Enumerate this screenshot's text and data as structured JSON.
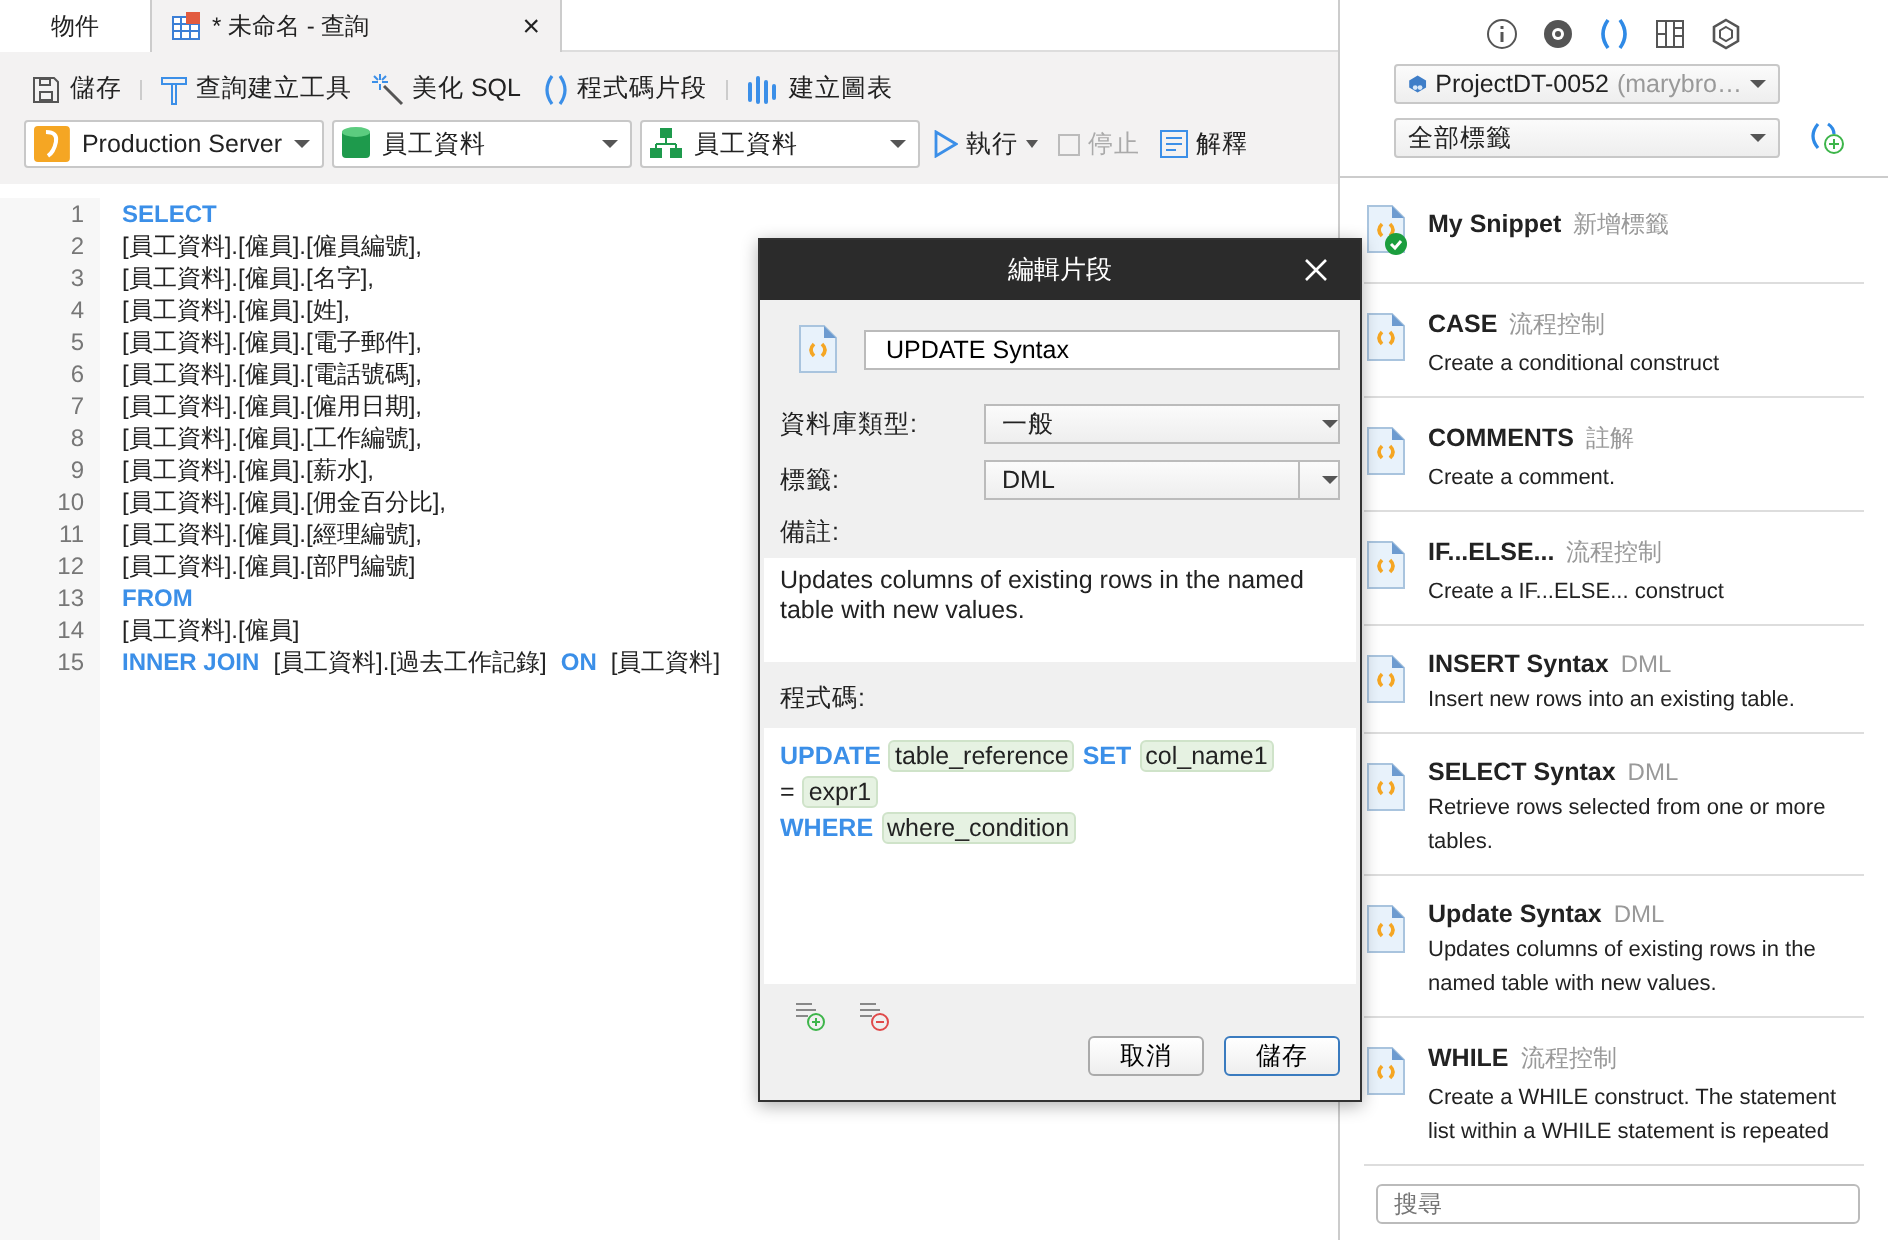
{
  "tabs": [
    {
      "label": "物件",
      "selected": false
    },
    {
      "label": "* 未命名 - 查詢",
      "selected": true,
      "close": "×"
    }
  ],
  "toolbar": {
    "buttons": [
      "儲存",
      "查詢建立工具",
      "美化 SQL",
      "程式碼片段",
      "建立圖表"
    ]
  },
  "selectors": {
    "connection": "Production Server",
    "database": "員工資料",
    "schema": "員工資料",
    "run": "執行",
    "stop": {
      "label": "停止",
      "disabled": true
    },
    "explain": "解釋"
  },
  "editor": {
    "lines": [
      {
        "number": "1",
        "tokens": [
          {
            "kind": "keyword",
            "text": "SELECT"
          }
        ]
      },
      {
        "number": "2",
        "tokens": [
          {
            "kind": "plain",
            "text": "[員工資料].[僱員].[僱員編號],"
          }
        ]
      },
      {
        "number": "3",
        "tokens": [
          {
            "kind": "plain",
            "text": "[員工資料].[僱員].[名字],"
          }
        ]
      },
      {
        "number": "4",
        "tokens": [
          {
            "kind": "plain",
            "text": "[員工資料].[僱員].[姓],"
          }
        ]
      },
      {
        "number": "5",
        "tokens": [
          {
            "kind": "plain",
            "text": "[員工資料].[僱員].[電子郵件],"
          }
        ]
      },
      {
        "number": "6",
        "tokens": [
          {
            "kind": "plain",
            "text": "[員工資料].[僱員].[電話號碼],"
          }
        ]
      },
      {
        "number": "7",
        "tokens": [
          {
            "kind": "plain",
            "text": "[員工資料].[僱員].[僱用日期],"
          }
        ]
      },
      {
        "number": "8",
        "tokens": [
          {
            "kind": "plain",
            "text": "[員工資料].[僱員].[工作編號],"
          }
        ]
      },
      {
        "number": "9",
        "tokens": [
          {
            "kind": "plain",
            "text": "[員工資料].[僱員].[薪水],"
          }
        ]
      },
      {
        "number": "10",
        "tokens": [
          {
            "kind": "plain",
            "text": "[員工資料].[僱員].[佣金百分比],"
          }
        ]
      },
      {
        "number": "11",
        "tokens": [
          {
            "kind": "plain",
            "text": "[員工資料].[僱員].[經理編號],"
          }
        ]
      },
      {
        "number": "12",
        "tokens": [
          {
            "kind": "plain",
            "text": "[員工資料].[僱員].[部門編號]"
          }
        ]
      },
      {
        "number": "13",
        "tokens": [
          {
            "kind": "keyword",
            "text": "FROM"
          }
        ]
      },
      {
        "number": "14",
        "tokens": [
          {
            "kind": "plain",
            "text": "[員工資料].[僱員]"
          }
        ]
      },
      {
        "number": "15",
        "tokens": [
          {
            "kind": "keyword",
            "text": "INNER JOIN"
          },
          {
            "kind": "plain",
            "text": "[員工資料].[過去工作記錄]"
          },
          {
            "kind": "keyword",
            "text": "ON"
          },
          {
            "kind": "plain",
            "text": "[員工資料]"
          }
        ]
      }
    ]
  },
  "dialog": {
    "title": "編輯片段",
    "name": "UPDATE Syntax",
    "db_type_label": "資料庫類型:",
    "db_type": "一般",
    "tag_label": "標籤:",
    "tag": "DML",
    "note_label": "備註:",
    "note": "Updates columns of existing rows in the named table with new values.",
    "code_label": "程式碼:",
    "code": [
      [
        {
          "kind": "keyword",
          "text": "UPDATE"
        },
        {
          "kind": "placeholder",
          "text": "table_reference"
        },
        {
          "kind": "keyword",
          "text": "SET"
        },
        {
          "kind": "placeholder",
          "text": "col_name1"
        }
      ],
      [
        {
          "kind": "plain",
          "text": "="
        },
        {
          "kind": "placeholder",
          "text": "expr1"
        }
      ],
      [
        {
          "kind": "keyword",
          "text": "WHERE"
        },
        {
          "kind": "placeholder",
          "text": "where_condition"
        }
      ]
    ],
    "cancel": "取消",
    "save": "儲存"
  },
  "panel": {
    "tabs": [
      {
        "selected": false
      },
      {
        "selected": false
      },
      {
        "selected": true
      },
      {
        "selected": false
      },
      {
        "selected": false
      }
    ],
    "project": "ProjectDT-0052",
    "owner": "(marybro…",
    "tag_filter": "全部標籤",
    "snippets": [
      {
        "name": "My Snippet",
        "tag": "新增標籤",
        "mine": true
      },
      {
        "name": "CASE",
        "tag": "流程控制",
        "description": "Create a conditional construct",
        "mine": false
      },
      {
        "name": "COMMENTS",
        "tag": "註解",
        "description": "Create a comment.",
        "mine": false
      },
      {
        "name": "IF...ELSE...",
        "tag": "流程控制",
        "description": "Create a IF...ELSE... construct",
        "mine": false
      },
      {
        "name": "INSERT Syntax",
        "tag": "DML",
        "description": "Insert new rows into an existing table.",
        "mine": false
      },
      {
        "name": "SELECT Syntax",
        "tag": "DML",
        "description": "Retrieve rows selected from one or more tables.",
        "mine": false
      },
      {
        "name": "Update Syntax",
        "tag": "DML",
        "description": "Updates columns of existing rows in the named table with new values.",
        "mine": false
      },
      {
        "name": "WHILE",
        "tag": "流程控制",
        "description": "Create a WHILE construct. The statement list within a WHILE statement is repeated",
        "mine": false
      }
    ],
    "search": {
      "placeholder": "搜尋"
    }
  }
}
